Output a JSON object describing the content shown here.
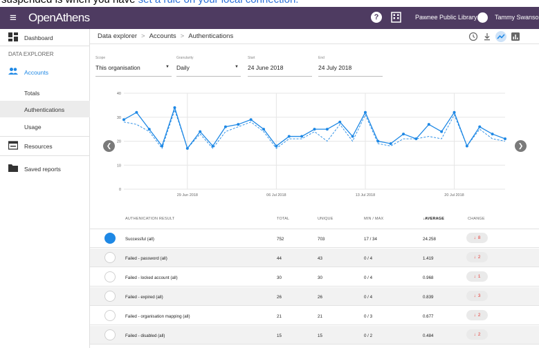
{
  "banner": {
    "text": "suspended is when you have",
    "link": "set a rule on your local connection."
  },
  "appbar": {
    "logo": "OpenAthens",
    "help_glyph": "?",
    "org": "Pawnee Public Library",
    "user": "Tammy Swanson"
  },
  "sidebar": {
    "dashboard": "Dashboard",
    "section": "DATA EXPLORER",
    "accounts": "Accounts",
    "totals": "Totals",
    "authentications": "Authentications",
    "usage": "Usage",
    "resources": "Resources",
    "saved_reports": "Saved reports"
  },
  "breadcrumb": [
    "Data explorer",
    "Accounts",
    "Authentications"
  ],
  "breadcrumb_sep": ">",
  "filters": {
    "scope": {
      "label": "Scope",
      "value": "This organisation"
    },
    "granularity": {
      "label": "Granularity",
      "value": "Daily"
    },
    "start": {
      "label": "Start",
      "value": "24 June 2018"
    },
    "end": {
      "label": "End",
      "value": "24 July 2018"
    }
  },
  "colors": {
    "appbar": "#4e3b61",
    "accent": "#1e88e5",
    "change_down": "#e53935"
  },
  "icons": [
    "menu-icon",
    "help-icon",
    "building-icon",
    "account-circle-icon",
    "dashboard-icon",
    "people-icon",
    "resources-icon",
    "folder-icon",
    "clock-icon",
    "download-icon",
    "trend-icon",
    "bar-chart-icon",
    "chevron-left-icon",
    "chevron-right-icon",
    "arrow-down-icon"
  ],
  "chart_data": {
    "type": "line",
    "x": [
      "24 Jun 2018",
      "25 Jun 2018",
      "26 Jun 2018",
      "27 Jun 2018",
      "28 Jun 2018",
      "29 Jun 2018",
      "30 Jun 2018",
      "01 Jul 2018",
      "02 Jul 2018",
      "03 Jul 2018",
      "04 Jul 2018",
      "05 Jul 2018",
      "06 Jul 2018",
      "07 Jul 2018",
      "08 Jul 2018",
      "09 Jul 2018",
      "10 Jul 2018",
      "11 Jul 2018",
      "12 Jul 2018",
      "13 Jul 2018",
      "14 Jul 2018",
      "15 Jul 2018",
      "16 Jul 2018",
      "17 Jul 2018",
      "18 Jul 2018",
      "19 Jul 2018",
      "20 Jul 2018",
      "21 Jul 2018",
      "22 Jul 2018",
      "23 Jul 2018",
      "24 Jul 2018"
    ],
    "tick_labels": [
      "29 Jun 2018",
      "06 Jul 2018",
      "13 Jul 2018",
      "20 Jul 2018"
    ],
    "series": [
      {
        "values": [
          29,
          32,
          25,
          18,
          34,
          17,
          24,
          18,
          26,
          27,
          29,
          25,
          18,
          22,
          22,
          25,
          25,
          28,
          22,
          32,
          20,
          19,
          23,
          21,
          27,
          24,
          32,
          18,
          26,
          23,
          21
        ],
        "style": "solid"
      },
      {
        "values": [
          28,
          27,
          24,
          17,
          33,
          17,
          23,
          17,
          24,
          26,
          28,
          24,
          17,
          21,
          21,
          24,
          20,
          27,
          20,
          31,
          19,
          18,
          21,
          21,
          22,
          21,
          31,
          18,
          25,
          21,
          20
        ],
        "style": "dashed"
      }
    ],
    "ylim": [
      0,
      40
    ],
    "yticks": [
      0,
      10,
      20,
      30,
      40
    ],
    "grid": true
  },
  "table": {
    "headers": {
      "result": "AUTHENICATION RESULT",
      "total": "TOTAL",
      "unique": "UNIQUE",
      "minmax": "MIN / MAX",
      "average": "AVERAGE",
      "change": "CHANGE"
    },
    "sort_arrow": "↓",
    "rows": [
      {
        "result": "Successful (all)",
        "total": "752",
        "unique": "703",
        "minmax": "17 / 34",
        "average": "24.258",
        "change": "8",
        "selected": true
      },
      {
        "result": "Failed - password (all)",
        "total": "44",
        "unique": "43",
        "minmax": "0 / 4",
        "average": "1.419",
        "change": "2",
        "selected": false
      },
      {
        "result": "Failed - locked account (all)",
        "total": "30",
        "unique": "30",
        "minmax": "0 / 4",
        "average": "0.968",
        "change": "1",
        "selected": false
      },
      {
        "result": "Failed - expired (all)",
        "total": "26",
        "unique": "26",
        "minmax": "0 / 4",
        "average": "0.839",
        "change": "3",
        "selected": false
      },
      {
        "result": "Failed - organisation mapping (all)",
        "total": "21",
        "unique": "21",
        "minmax": "0 / 3",
        "average": "0.677",
        "change": "2",
        "selected": false
      },
      {
        "result": "Failed - disabled (all)",
        "total": "15",
        "unique": "15",
        "minmax": "0 / 2",
        "average": "0.484",
        "change": "2",
        "selected": false
      }
    ]
  }
}
